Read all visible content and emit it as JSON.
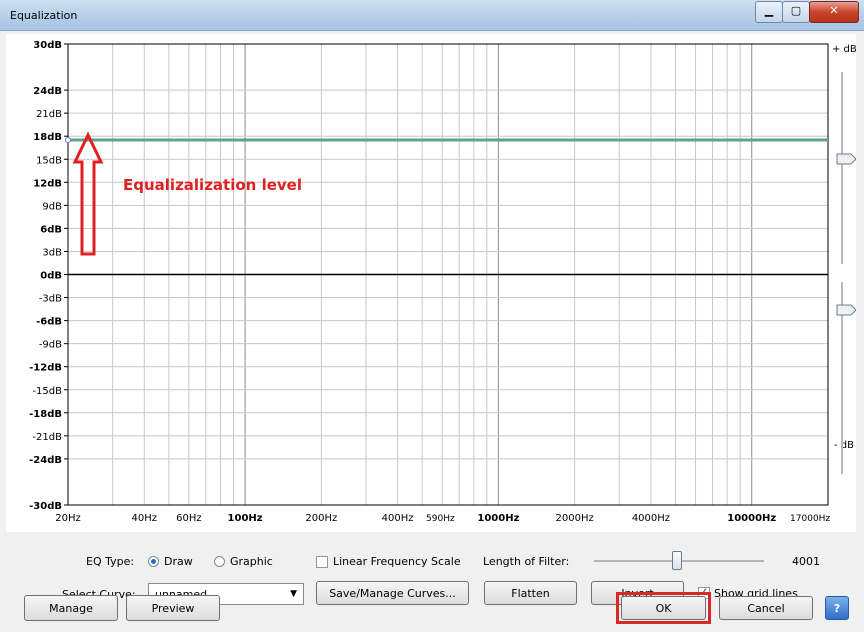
{
  "window": {
    "title": "Equalization"
  },
  "plot": {
    "db_labels": [
      "30dB",
      "24dB",
      "21dB",
      "18dB",
      "15dB",
      "12dB",
      "9dB",
      "6dB",
      "3dB",
      "0dB",
      "-3dB",
      "-6dB",
      "-9dB",
      "-12dB",
      "-15dB",
      "-18dB",
      "-21dB",
      "-24dB",
      "-30dB"
    ],
    "freq_labels": [
      "20Hz",
      "40Hz",
      "60Hz",
      "100Hz",
      "200Hz",
      "400Hz",
      "590Hz",
      "1000Hz",
      "2000Hz",
      "4000Hz",
      "10000Hz",
      "17000Hz"
    ],
    "right_top_label": "+ dB",
    "right_bottom_label": "- dB",
    "eq_level_db": 17.5,
    "annotation": "Equalizalization level"
  },
  "controls": {
    "eq_type_label": "EQ Type:",
    "draw_label": "Draw",
    "graphic_label": "Graphic",
    "linear_freq_label": "Linear Frequency Scale",
    "filter_length_label": "Length of Filter:",
    "filter_length_value": "4001",
    "select_curve_label": "Select Curve:",
    "curve_value": "unnamed",
    "save_manage_label": "Save/Manage Curves...",
    "flatten_label": "Flatten",
    "invert_label": "Invert",
    "show_grid_label": "Show grid lines",
    "manage_label": "Manage",
    "preview_label": "Preview",
    "ok_label": "OK",
    "cancel_label": "Cancel",
    "help_label": "?"
  },
  "colors": {
    "curve": "#5aa38e",
    "annotation": "#e02020"
  }
}
